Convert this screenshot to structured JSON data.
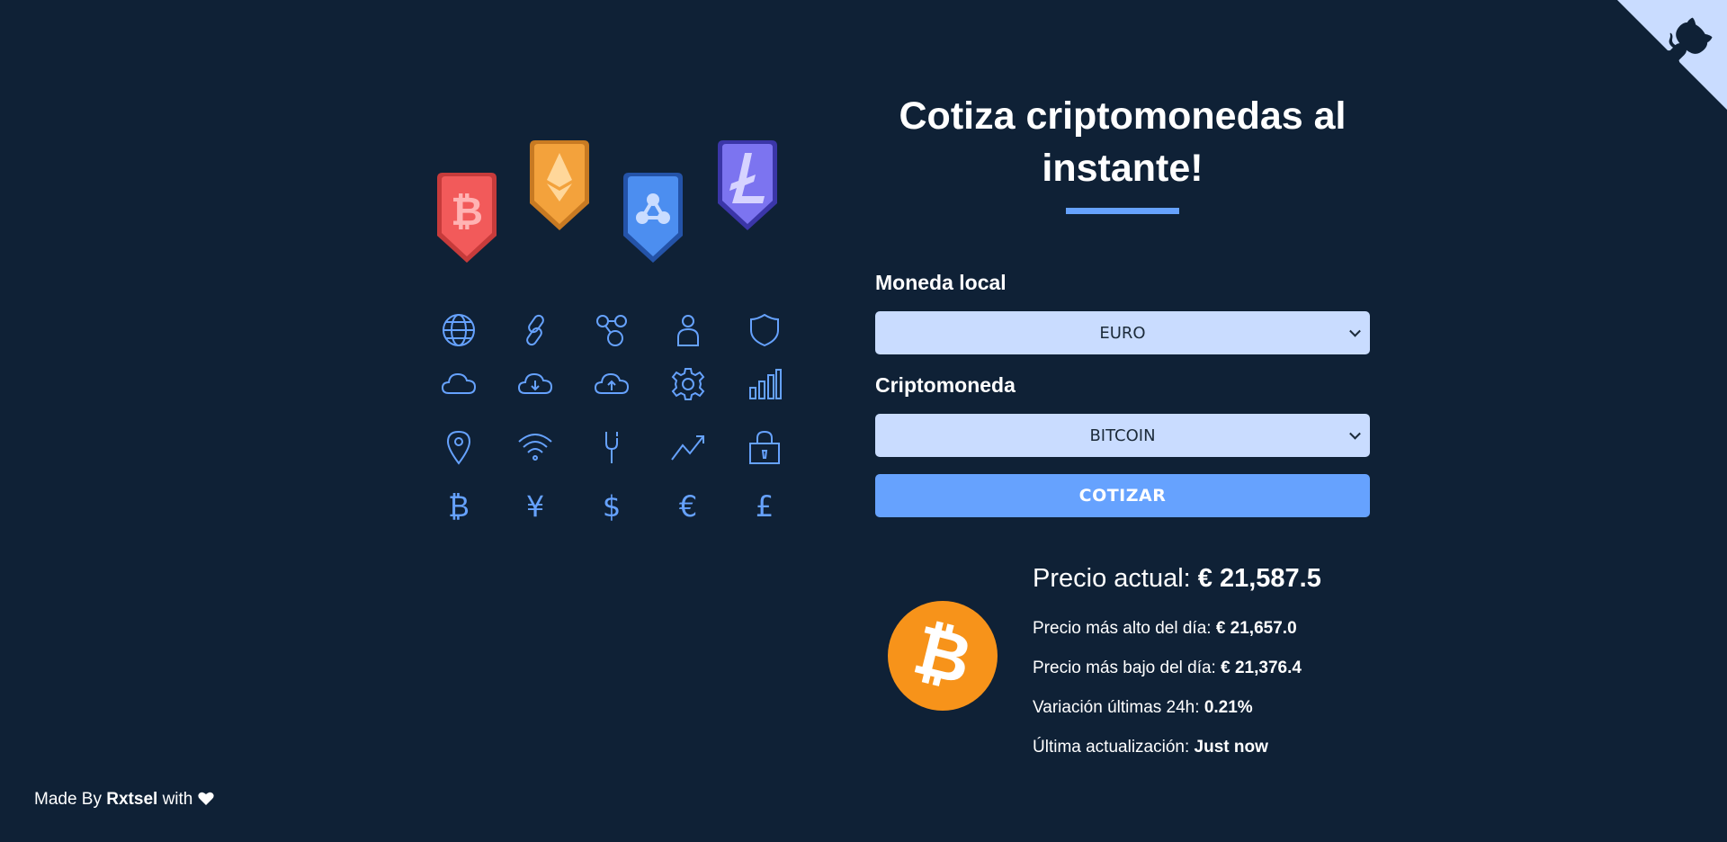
{
  "header": {
    "title_line1": "Cotiza criptomonedas al",
    "title_line2": "instante!"
  },
  "form": {
    "currency_label": "Moneda local",
    "currency_value": "EURO",
    "crypto_label": "Criptomoneda",
    "crypto_value": "BITCOIN",
    "submit_label": "COTIZAR"
  },
  "result": {
    "current_price_label": "Precio actual:",
    "current_price_value": "€ 21,587.5",
    "high_label": "Precio más alto del día:",
    "high_value": "€ 21,657.0",
    "low_label": "Precio más bajo del día:",
    "low_value": "€ 21,376.4",
    "change_label": "Variación últimas 24h:",
    "change_value": "0.21%",
    "updated_label": "Última actualización:",
    "updated_value": "Just now"
  },
  "footer": {
    "prefix": "Made By",
    "author": "Rxtsel",
    "suffix": "with"
  },
  "icons": {
    "badges": [
      "bitcoin-badge-icon",
      "ethereum-badge-icon",
      "ripple-badge-icon",
      "litecoin-badge-icon"
    ],
    "grid": [
      "globe-icon",
      "link-icon",
      "network-icon",
      "user-icon",
      "shield-icon",
      "cloud-icon",
      "cloud-download-icon",
      "cloud-upload-icon",
      "gear-icon",
      "bar-chart-icon",
      "map-pin-icon",
      "wifi-icon",
      "fork-icon",
      "trend-up-icon",
      "lock-icon",
      "bitcoin-icon",
      "yen-icon",
      "dollar-icon",
      "euro-icon",
      "pound-icon"
    ],
    "github": "github-corner-icon",
    "coin": "bitcoin-logo-icon",
    "heart": "heart-icon"
  },
  "colors": {
    "background": "#0f2136",
    "accent": "#66a2fe",
    "select_bg": "#c9dcff",
    "bitcoin_orange": "#f7931a",
    "badge_red": "#f25a5a",
    "badge_orange": "#f3a23c",
    "badge_blue": "#4c8ef0",
    "badge_purple": "#7c74f0"
  }
}
